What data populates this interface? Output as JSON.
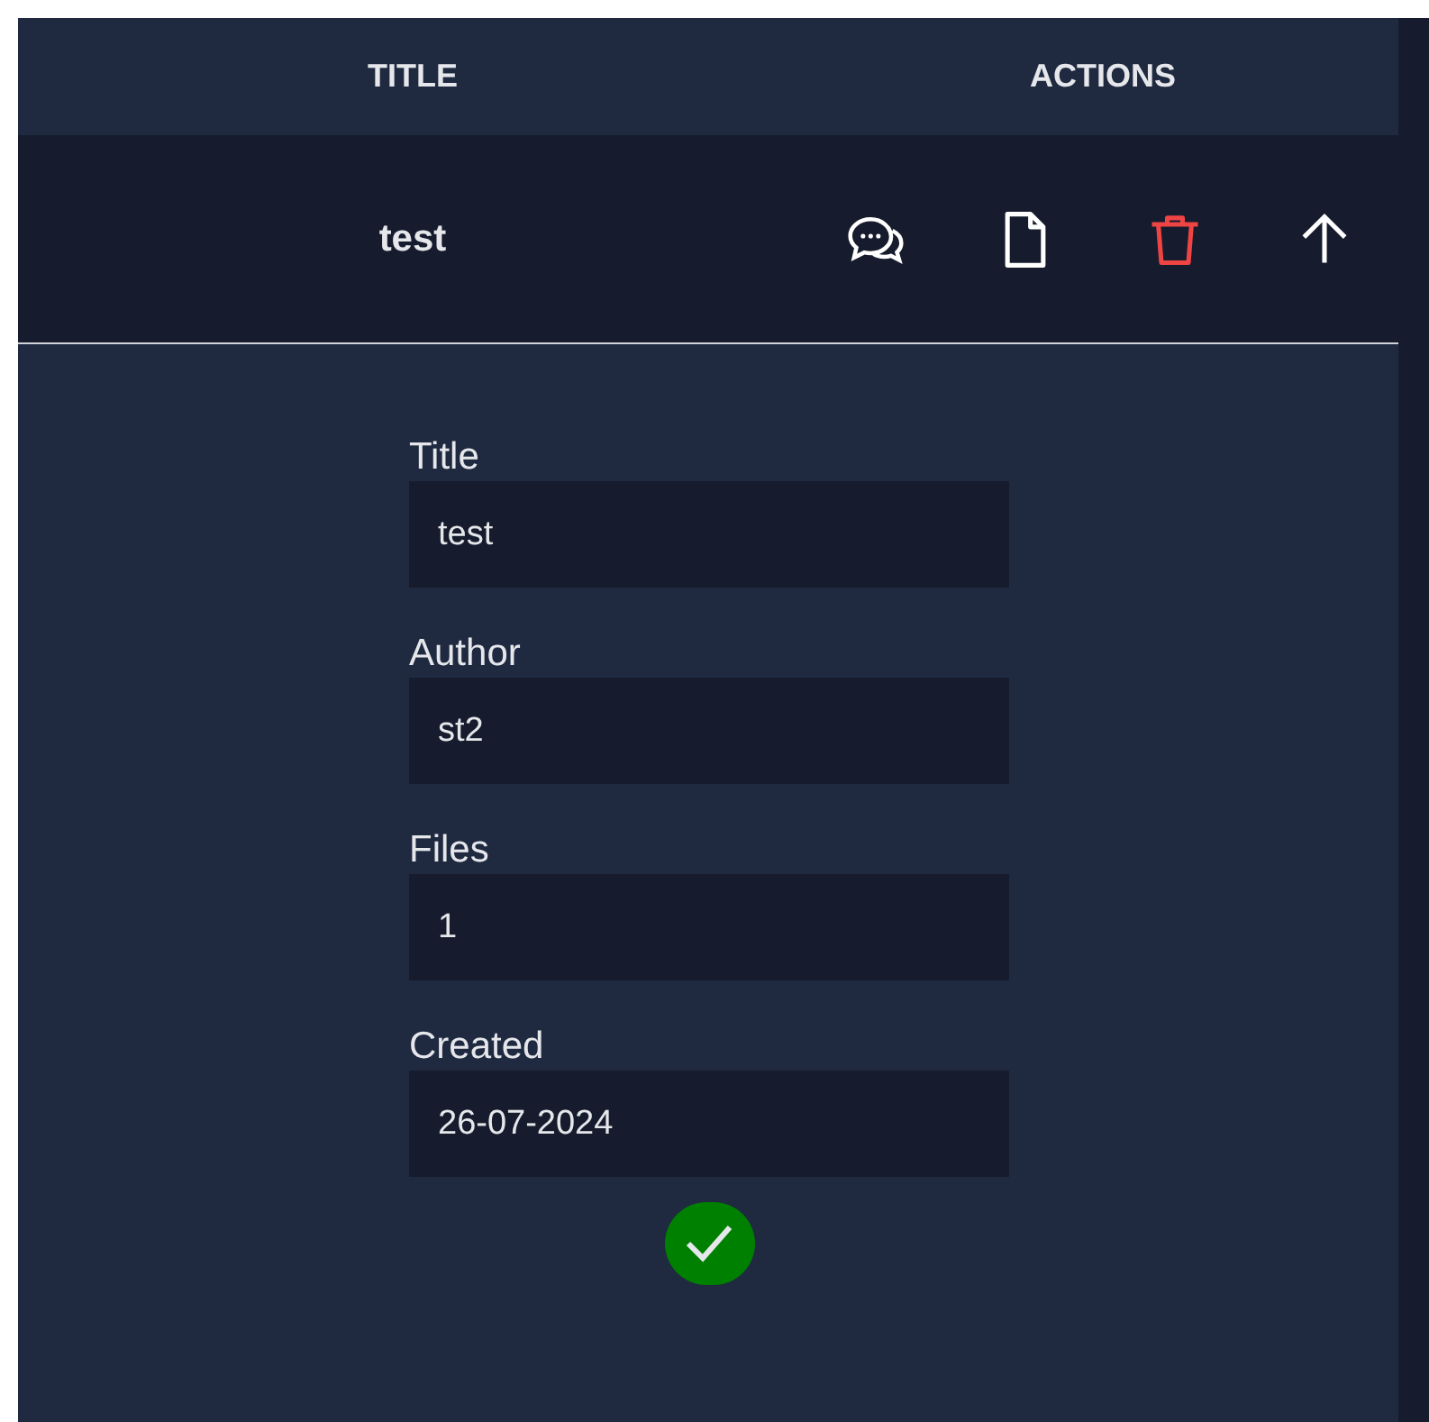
{
  "table": {
    "columns": [
      "TITLE",
      "ACTIONS"
    ],
    "rows": [
      {
        "title": "test",
        "expanded": true,
        "actions": [
          {
            "kind": "comments"
          },
          {
            "kind": "file"
          },
          {
            "kind": "delete"
          },
          {
            "kind": "move-up"
          }
        ],
        "details": {
          "fields": [
            {
              "label": "Title",
              "value": "test"
            },
            {
              "label": "Author",
              "value": "st2"
            },
            {
              "label": "Files",
              "value": "1"
            },
            {
              "label": "Created",
              "value": "26-07-2024"
            }
          ]
        }
      }
    ]
  }
}
